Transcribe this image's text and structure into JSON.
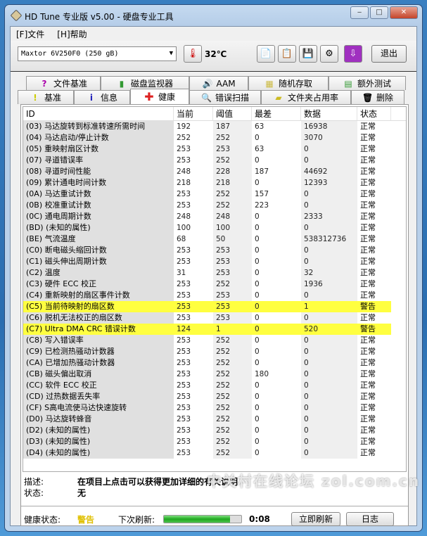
{
  "window": {
    "title": "HD Tune 专业版 v5.00 - 硬盘专业工具",
    "min": "‒",
    "max": "□",
    "close": "✕"
  },
  "menu": [
    "[F]文件",
    "[H]帮助"
  ],
  "toolbar": {
    "drive": "Maxtor 6V250F0 (250 gB)",
    "temperature": "32℃",
    "exit": "退出"
  },
  "tabs_row1": [
    "文件基准",
    "磁盘监视器",
    "AAM",
    "随机存取",
    "额外测试"
  ],
  "tabs_row2": [
    "基准",
    "信息",
    "健康",
    "错误扫描",
    "文件夹占用率",
    "删除"
  ],
  "active_tab": "健康",
  "table": {
    "headers": [
      "ID",
      "当前",
      "阈值",
      "最差",
      "数据",
      "状态"
    ],
    "rows": [
      [
        "(03) 马达旋转到标准转速所需时间",
        "192",
        "187",
        "63",
        "16938",
        "正常"
      ],
      [
        "(04) 马达启动/停止计数",
        "252",
        "252",
        "0",
        "3070",
        "正常"
      ],
      [
        "(05) 重映射扇区计数",
        "253",
        "253",
        "63",
        "0",
        "正常"
      ],
      [
        "(07) 寻道错误率",
        "253",
        "252",
        "0",
        "0",
        "正常"
      ],
      [
        "(08) 寻道时间性能",
        "248",
        "228",
        "187",
        "44692",
        "正常"
      ],
      [
        "(09) 累计通电时间计数",
        "218",
        "218",
        "0",
        "12393",
        "正常"
      ],
      [
        "(0A) 马达重试计数",
        "253",
        "252",
        "157",
        "0",
        "正常"
      ],
      [
        "(0B) 校准重试计数",
        "253",
        "252",
        "223",
        "0",
        "正常"
      ],
      [
        "(0C) 通电周期计数",
        "248",
        "248",
        "0",
        "2333",
        "正常"
      ],
      [
        "(BD) (未知的属性)",
        "100",
        "100",
        "0",
        "0",
        "正常"
      ],
      [
        "(BE) 气流温度",
        "68",
        "50",
        "0",
        "538312736",
        "正常"
      ],
      [
        "(C0) 断电磁头缩回计数",
        "253",
        "253",
        "0",
        "0",
        "正常"
      ],
      [
        "(C1) 磁头伸出周期计数",
        "253",
        "253",
        "0",
        "0",
        "正常"
      ],
      [
        "(C2) 温度",
        "31",
        "253",
        "0",
        "32",
        "正常"
      ],
      [
        "(C3) 硬件 ECC 校正",
        "253",
        "252",
        "0",
        "1936",
        "正常"
      ],
      [
        "(C4) 重新映射的扇区事件计数",
        "253",
        "253",
        "0",
        "0",
        "正常"
      ],
      [
        "(C5) 当前待映射的扇区数",
        "253",
        "253",
        "0",
        "1",
        "警告"
      ],
      [
        "(C6) 脱机无法校正的扇区数",
        "253",
        "253",
        "0",
        "0",
        "正常"
      ],
      [
        "(C7) Ultra DMA CRC 错误计数",
        "124",
        "1",
        "0",
        "520",
        "警告"
      ],
      [
        "(C8) 写入错误率",
        "253",
        "252",
        "0",
        "0",
        "正常"
      ],
      [
        "(C9) 已检测热骚动计数器",
        "253",
        "252",
        "0",
        "0",
        "正常"
      ],
      [
        "(CA) 已增加热骚动计数器",
        "253",
        "252",
        "0",
        "0",
        "正常"
      ],
      [
        "(CB) 磁头偏出取消",
        "253",
        "252",
        "180",
        "0",
        "正常"
      ],
      [
        "(CC) 软件 ECC 校正",
        "253",
        "252",
        "0",
        "0",
        "正常"
      ],
      [
        "(CD) 过热数据丢失率",
        "253",
        "252",
        "0",
        "0",
        "正常"
      ],
      [
        "(CF) S高电流使马达快速旋转",
        "253",
        "252",
        "0",
        "0",
        "正常"
      ],
      [
        "(D0) 马达旋转蜂音",
        "253",
        "252",
        "0",
        "0",
        "正常"
      ],
      [
        "(D2) (未知的属性)",
        "253",
        "252",
        "0",
        "0",
        "正常"
      ],
      [
        "(D3) (未知的属性)",
        "253",
        "252",
        "0",
        "0",
        "正常"
      ],
      [
        "(D4) (未知的属性)",
        "253",
        "252",
        "0",
        "0",
        "正常"
      ]
    ]
  },
  "description": {
    "label": "描述:",
    "text": "在项目上点击可以获得更加详细的有关说明",
    "status_label": "状态:",
    "status": "无"
  },
  "status_bar": {
    "health_label": "健康状态:",
    "health": "警告",
    "refresh_label": "下次刷新:",
    "progress": 0.85,
    "countdown": "0:08",
    "refresh_now": "立即刷新",
    "log": "日志"
  },
  "watermark": "中关村在线论坛 zol.com.cn",
  "colors": {
    "warn_row": "#ffff40",
    "health_warn": "#e0c000"
  }
}
